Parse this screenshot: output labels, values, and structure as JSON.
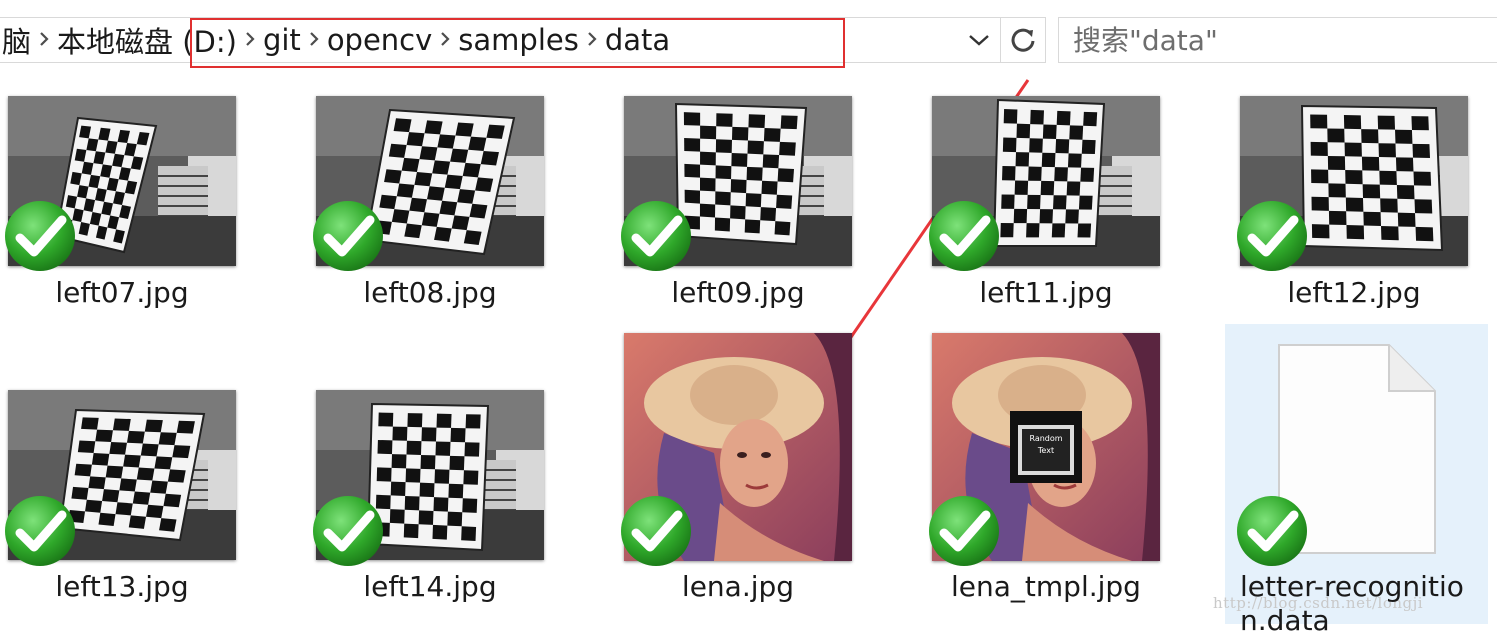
{
  "address_bar": {
    "crumbs": [
      "脑",
      "本地磁盘 (D:)",
      "git",
      "opencv",
      "samples",
      "data"
    ]
  },
  "search": {
    "placeholder": "搜索\"data\""
  },
  "files": [
    {
      "name": "left07.jpg",
      "type": "checkerboard",
      "status": "synced"
    },
    {
      "name": "left08.jpg",
      "type": "checkerboard",
      "status": "synced"
    },
    {
      "name": "left09.jpg",
      "type": "checkerboard",
      "status": "synced"
    },
    {
      "name": "left11.jpg",
      "type": "checkerboard",
      "status": "synced"
    },
    {
      "name": "left12.jpg",
      "type": "checkerboard",
      "status": "synced"
    },
    {
      "name": "left13.jpg",
      "type": "checkerboard",
      "status": "synced"
    },
    {
      "name": "left14.jpg",
      "type": "checkerboard",
      "status": "synced"
    },
    {
      "name": "lena.jpg",
      "type": "portrait",
      "status": "synced"
    },
    {
      "name": "lena_tmpl.jpg",
      "type": "portrait-template",
      "status": "synced",
      "overlay_text": [
        "Random",
        "Text"
      ]
    },
    {
      "name": "letter-recognition.data",
      "type": "document",
      "status": "synced",
      "selected": true
    }
  ],
  "watermark": "http://blog.csdn.net/longji",
  "colors": {
    "highlight": "#e03030",
    "check_green": "#2fa82a",
    "selection": "#e5f1fb",
    "arrow": "#e8363a"
  }
}
